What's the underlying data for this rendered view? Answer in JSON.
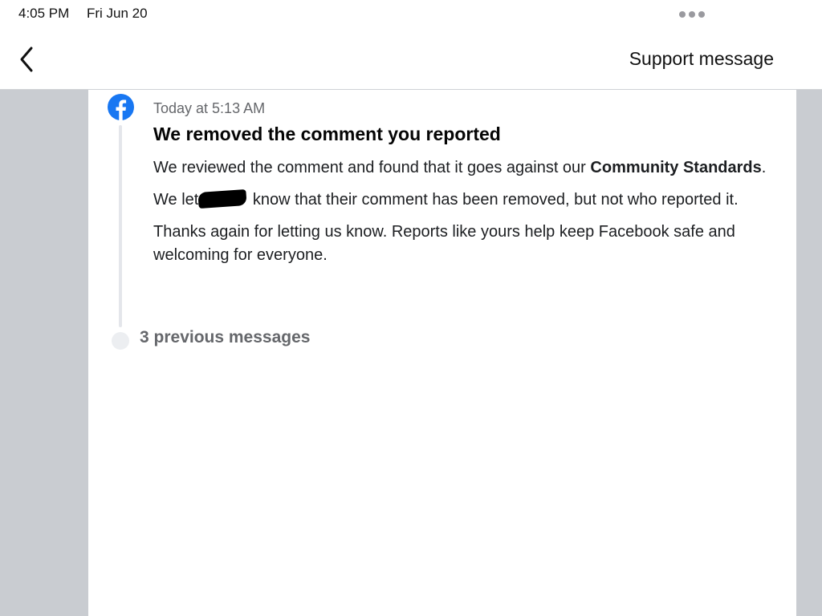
{
  "status_bar": {
    "time": "4:05 PM",
    "date": "Fri Jun 20"
  },
  "nav": {
    "back_icon": "chevron-left-icon",
    "title": "Support message"
  },
  "message": {
    "sender_icon": "facebook-icon",
    "brand_color": "#1877f2",
    "timestamp": "Today at 5:13 AM",
    "heading": "We removed the comment you reported",
    "p1_text": "We reviewed the comment and found that it goes against our ",
    "p1_bold": "Community Standards",
    "p1_end": ".",
    "p2_start": "We let",
    "p2_end": " know that their comment has been removed, but not who reported it.",
    "p3": "Thanks again for letting us know. Reports like yours help keep Facebook safe and welcoming for everyone."
  },
  "previous_messages": {
    "label": "3 previous messages"
  }
}
